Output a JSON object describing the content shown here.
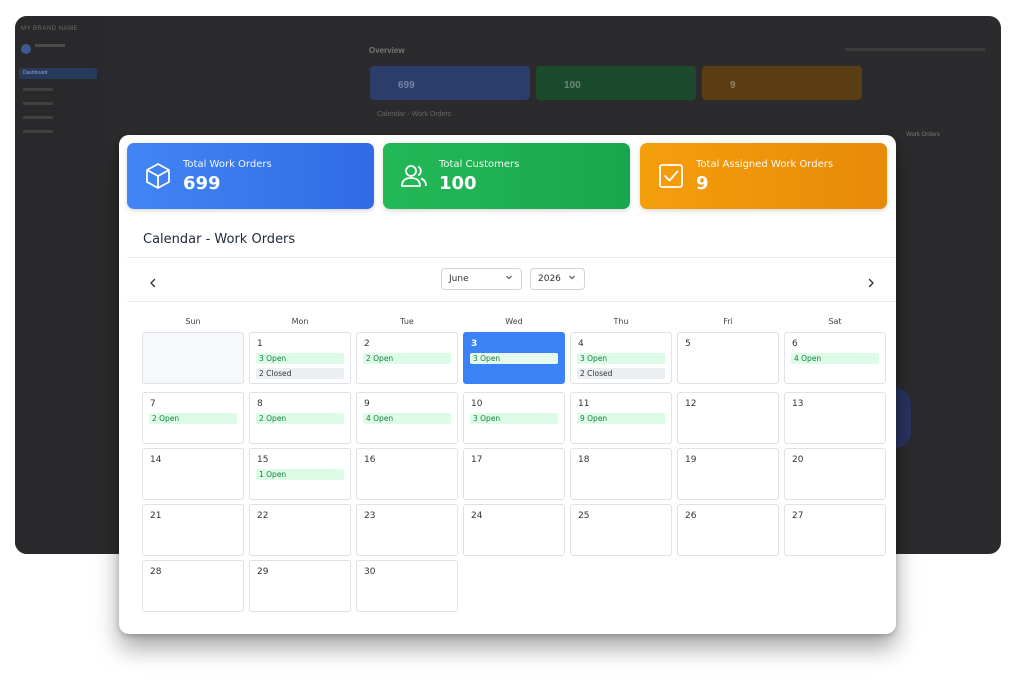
{
  "background": {
    "logo_text": "MY BRAND NAME",
    "nav_active": "Dashboard",
    "title": "Overview",
    "cards": [
      {
        "value": "699",
        "color": "#2b3d6b"
      },
      {
        "value": "100",
        "color": "#1c4a2c"
      },
      {
        "value": "9",
        "color": "#5a3d12"
      }
    ],
    "calendar_title": "Calendar - Work Orders",
    "right_title": "Work Orders"
  },
  "stats": [
    {
      "label": "Total Work Orders",
      "value": "699",
      "icon": "box-icon",
      "color": "#3b7cf1"
    },
    {
      "label": "Total Customers",
      "value": "100",
      "icon": "users-icon",
      "color": "#21b453"
    },
    {
      "label": "Total Assigned Work Orders",
      "value": "9",
      "icon": "checkbox-icon",
      "color": "#f09809"
    }
  ],
  "calendar": {
    "title": "Calendar - Work Orders",
    "month": "June",
    "year": "2026",
    "weekdays": [
      "Sun",
      "Mon",
      "Tue",
      "Wed",
      "Thu",
      "Fri",
      "Sat"
    ],
    "days": [
      {
        "n": "1",
        "open": "3 Open",
        "closed": "2 Closed"
      },
      {
        "n": "2",
        "open": "2 Open"
      },
      {
        "n": "3",
        "open": "3 Open",
        "today": true
      },
      {
        "n": "4",
        "open": "3 Open",
        "closed": "2 Closed"
      },
      {
        "n": "5"
      },
      {
        "n": "6",
        "open": "4 Open"
      },
      {
        "n": "7",
        "open": "2 Open"
      },
      {
        "n": "8",
        "open": "2 Open"
      },
      {
        "n": "9",
        "open": "4 Open"
      },
      {
        "n": "10",
        "open": "3 Open"
      },
      {
        "n": "11",
        "open": "9 Open"
      },
      {
        "n": "12"
      },
      {
        "n": "13"
      },
      {
        "n": "14"
      },
      {
        "n": "15",
        "open": "1 Open"
      },
      {
        "n": "16"
      },
      {
        "n": "17"
      },
      {
        "n": "18"
      },
      {
        "n": "19"
      },
      {
        "n": "20"
      },
      {
        "n": "21"
      },
      {
        "n": "22"
      },
      {
        "n": "23"
      },
      {
        "n": "24"
      },
      {
        "n": "25"
      },
      {
        "n": "26"
      },
      {
        "n": "27"
      },
      {
        "n": "28"
      },
      {
        "n": "29"
      },
      {
        "n": "30"
      }
    ],
    "colors": {
      "today": "#3b82f6",
      "open_bg": "#dcfce7",
      "open_text": "#15803d",
      "closed_bg": "#eceff2"
    }
  }
}
